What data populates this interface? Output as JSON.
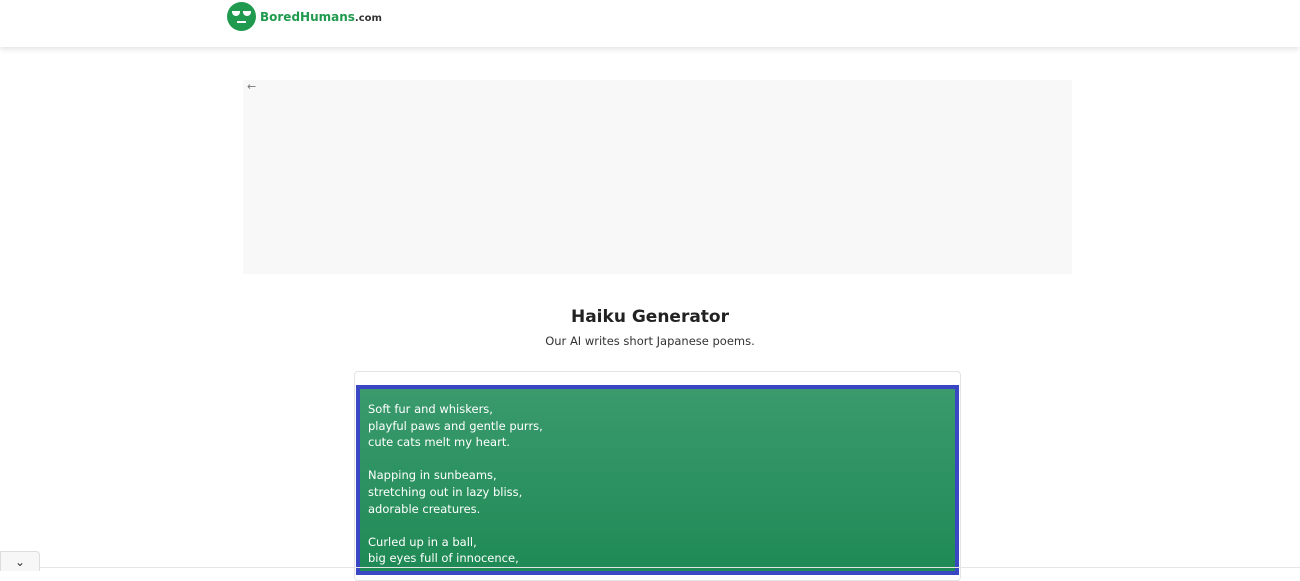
{
  "header": {
    "logo_text": "BoredHumans",
    "logo_suffix": ".com"
  },
  "ad": {
    "back_icon": "arrow-left-icon"
  },
  "main": {
    "title": "Haiku Generator",
    "subtitle": "Our AI writes short Japanese poems."
  },
  "output": {
    "text": "Soft fur and whiskers,\nplayful paws and gentle purrs,\ncute cats melt my heart.\n\nNapping in sunbeams,\nstretching out in lazy bliss,\nadorable creatures.\n\nCurled up in a ball,\nbig eyes full of innocence,"
  },
  "colors": {
    "brand": "#1f9a4e",
    "output_border": "#3a47c4",
    "output_bg": "#2a9160"
  }
}
